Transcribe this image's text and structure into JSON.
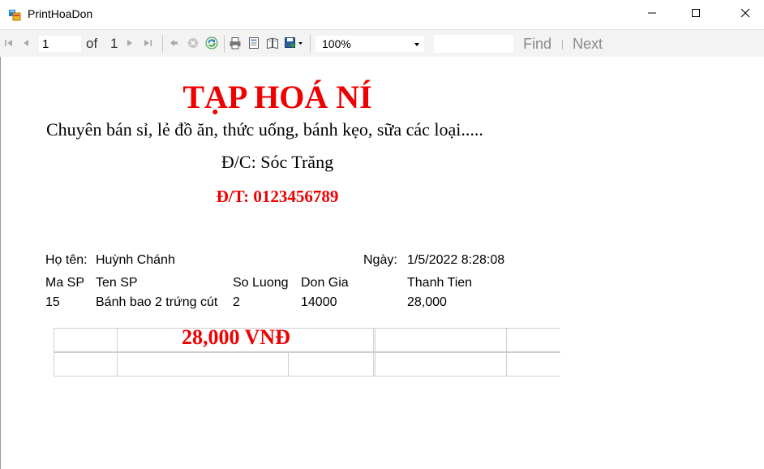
{
  "window": {
    "title": "PrintHoaDon",
    "icons": {
      "app": "app-window-icon",
      "minimize": "minimize-icon",
      "maximize": "maximize-icon",
      "close": "close-icon"
    }
  },
  "toolbar": {
    "current_page": "1",
    "of_label": "of",
    "total_pages": "1",
    "zoom": "100%",
    "find_value": "",
    "find_label": "Find",
    "next_label": "Next",
    "icons": [
      "first-page-icon",
      "previous-page-icon",
      "next-page-icon",
      "last-page-icon",
      "back-icon",
      "stop-icon",
      "refresh-icon",
      "print-icon",
      "print-layout-icon",
      "page-setup-icon",
      "export-icon"
    ]
  },
  "report": {
    "store_name": "TẠP HOÁ NÍ",
    "slogan": "Chuyên bán sỉ, lẻ đồ ăn, thức uống, bánh kẹo, sữa các loại.....",
    "address": "Đ/C: Sóc Trăng",
    "phone": "Đ/T: 0123456789",
    "customer_label": "Họ tên:",
    "customer_name": "Huỳnh Chánh",
    "date_label": "Ngày:",
    "date_value": "1/5/2022 8:28:08",
    "columns": [
      "Ma SP",
      "Ten SP",
      "So Luong",
      "Don Gia",
      "Thanh Tien"
    ],
    "rows": [
      {
        "ma_sp": "15",
        "ten_sp": "Bánh bao 2 trứng cút",
        "so_luong": "2",
        "don_gia": "14000",
        "thanh_tien": "28,000"
      }
    ],
    "total": "28,000  VNĐ"
  },
  "colors": {
    "accent_red": "#ee0000",
    "toolbar_bg": "#f3f3f3",
    "disabled_text": "#8a8a8a"
  }
}
